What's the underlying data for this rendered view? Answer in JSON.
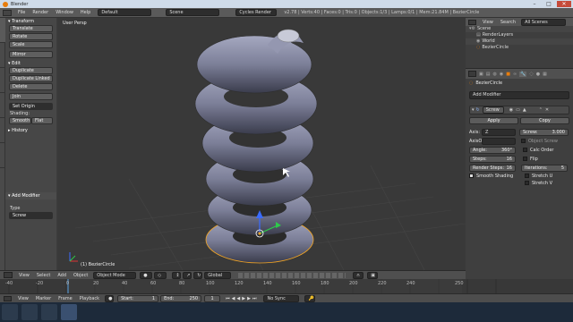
{
  "window": {
    "title": "Blender",
    "min": "–",
    "max": "□",
    "close": "✕"
  },
  "info": {
    "menus": [
      "File",
      "Render",
      "Window",
      "Help"
    ],
    "screen_layout": "Default",
    "scene": "Scene",
    "engine": "Cycles Render",
    "stats": "v2.78 | Verts:40 | Faces:0 | Tris:0 | Objects:1/3 | Lamps:0/1 | Mem:21.84M | BezierCircle"
  },
  "toolshelf": {
    "tabs": [
      "Tools",
      "Create",
      "Relations",
      "Animation",
      "Physics",
      "Grease Pencil"
    ],
    "transform_header": "▾ Transform",
    "transform_buttons": [
      "Translate",
      "Rotate",
      "Scale",
      "Mirror"
    ],
    "edit_header": "▾ Edit",
    "edit_buttons": [
      "Duplicate",
      "Duplicate Linked",
      "Delete",
      "Join"
    ],
    "set_origin": "Set Origin",
    "shading_label": "Shading:",
    "smooth": "Smooth",
    "flat": "Flat",
    "history_header": "▸ History",
    "add_modifier_header": "▾ Add Modifier",
    "type_label": "Type",
    "type_value": "Screw"
  },
  "viewport": {
    "view_label": "User Persp",
    "object_label": "(1) BezierCircle"
  },
  "view_header": {
    "menus": [
      "View",
      "Select",
      "Add",
      "Object"
    ],
    "mode": "Object Mode",
    "orientation": "Global"
  },
  "outliner": {
    "menus": [
      "View",
      "Search"
    ],
    "filter": "All Scenes",
    "items": [
      "Scene",
      "RenderLayers",
      "World",
      "BezierCircle"
    ]
  },
  "properties": {
    "breadcrumb": "BezierCircle",
    "add_modifier": "Add Modifier",
    "modifier_name": "Screw",
    "apply": "Apply",
    "copy": "Copy",
    "axis_label": "Axis:",
    "axis_value": "Z",
    "screw_label": "Screw:",
    "screw_value": "3.000",
    "axisob_label": "AxisO",
    "object_screw": "Object Screw",
    "angle_label": "Angle:",
    "angle_value": "360°",
    "calc_order": "Calc Order",
    "steps_label": "Steps:",
    "steps_value": "16",
    "flip": "Flip",
    "render_steps_label": "Render Steps:",
    "render_steps_value": "16",
    "iterations_label": "Iterations:",
    "iterations_value": "5",
    "smooth_shading": "Smooth Shading",
    "stretch_u": "Stretch U",
    "stretch_v": "Stretch V"
  },
  "timeline": {
    "ticks": [
      "-40",
      "-20",
      "0",
      "20",
      "40",
      "60",
      "80",
      "100",
      "120",
      "140",
      "160",
      "180",
      "200",
      "220",
      "240",
      "250"
    ],
    "menus": [
      "View",
      "Marker",
      "Frame",
      "Playback"
    ],
    "start_label": "Start:",
    "start_value": "1",
    "end_label": "End:",
    "end_value": "250",
    "current_value": "1",
    "sync": "No Sync"
  },
  "colors": {
    "accent": "#e87d0d",
    "selection": "#f5a623",
    "mesh": "#8c8ea8",
    "background": "#393939"
  }
}
